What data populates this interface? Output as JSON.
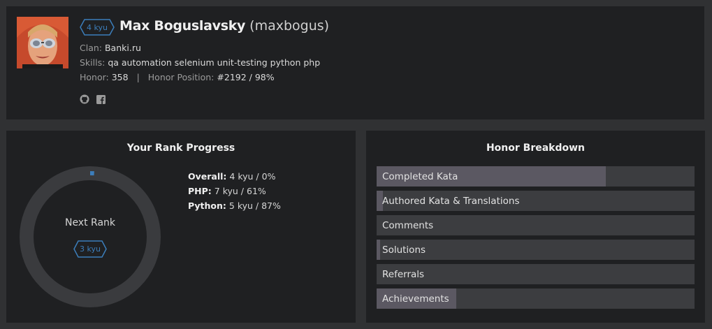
{
  "profile": {
    "rank_badge": "4 kyu",
    "name": "Max Boguslavsky",
    "username": "(maxbogus)",
    "clan_label": "Clan:",
    "clan": "Banki.ru",
    "skills_label": "Skills:",
    "skills": "qa automation selenium unit-testing python php",
    "honor_label": "Honor:",
    "honor": "358",
    "separator": "|",
    "honor_position_label": "Honor Position:",
    "honor_position": "#2192 / 98%",
    "social_icons": [
      "github-icon",
      "facebook-icon"
    ]
  },
  "rank_progress": {
    "title": "Your Rank Progress",
    "next_rank_label": "Next Rank",
    "next_rank_badge": "3 kyu",
    "overall_progress": 0.01,
    "items": [
      {
        "label": "Overall:",
        "value": "4 kyu / 0%"
      },
      {
        "label": "PHP:",
        "value": "7 kyu / 61%"
      },
      {
        "label": "Python:",
        "value": "5 kyu / 87%"
      }
    ]
  },
  "honor_breakdown": {
    "title": "Honor Breakdown",
    "items": [
      {
        "label": "Completed Kata",
        "fraction": 0.72
      },
      {
        "label": "Authored Kata & Translations",
        "fraction": 0.02
      },
      {
        "label": "Comments",
        "fraction": 0.0
      },
      {
        "label": "Solutions",
        "fraction": 0.01
      },
      {
        "label": "Referrals",
        "fraction": 0.0
      },
      {
        "label": "Achievements",
        "fraction": 0.25
      }
    ]
  },
  "colors": {
    "accent": "#3c7ebb",
    "ring": "#3a3b3e",
    "bar_fill": "#5b5862",
    "bar_bg": "#3c3d40"
  }
}
